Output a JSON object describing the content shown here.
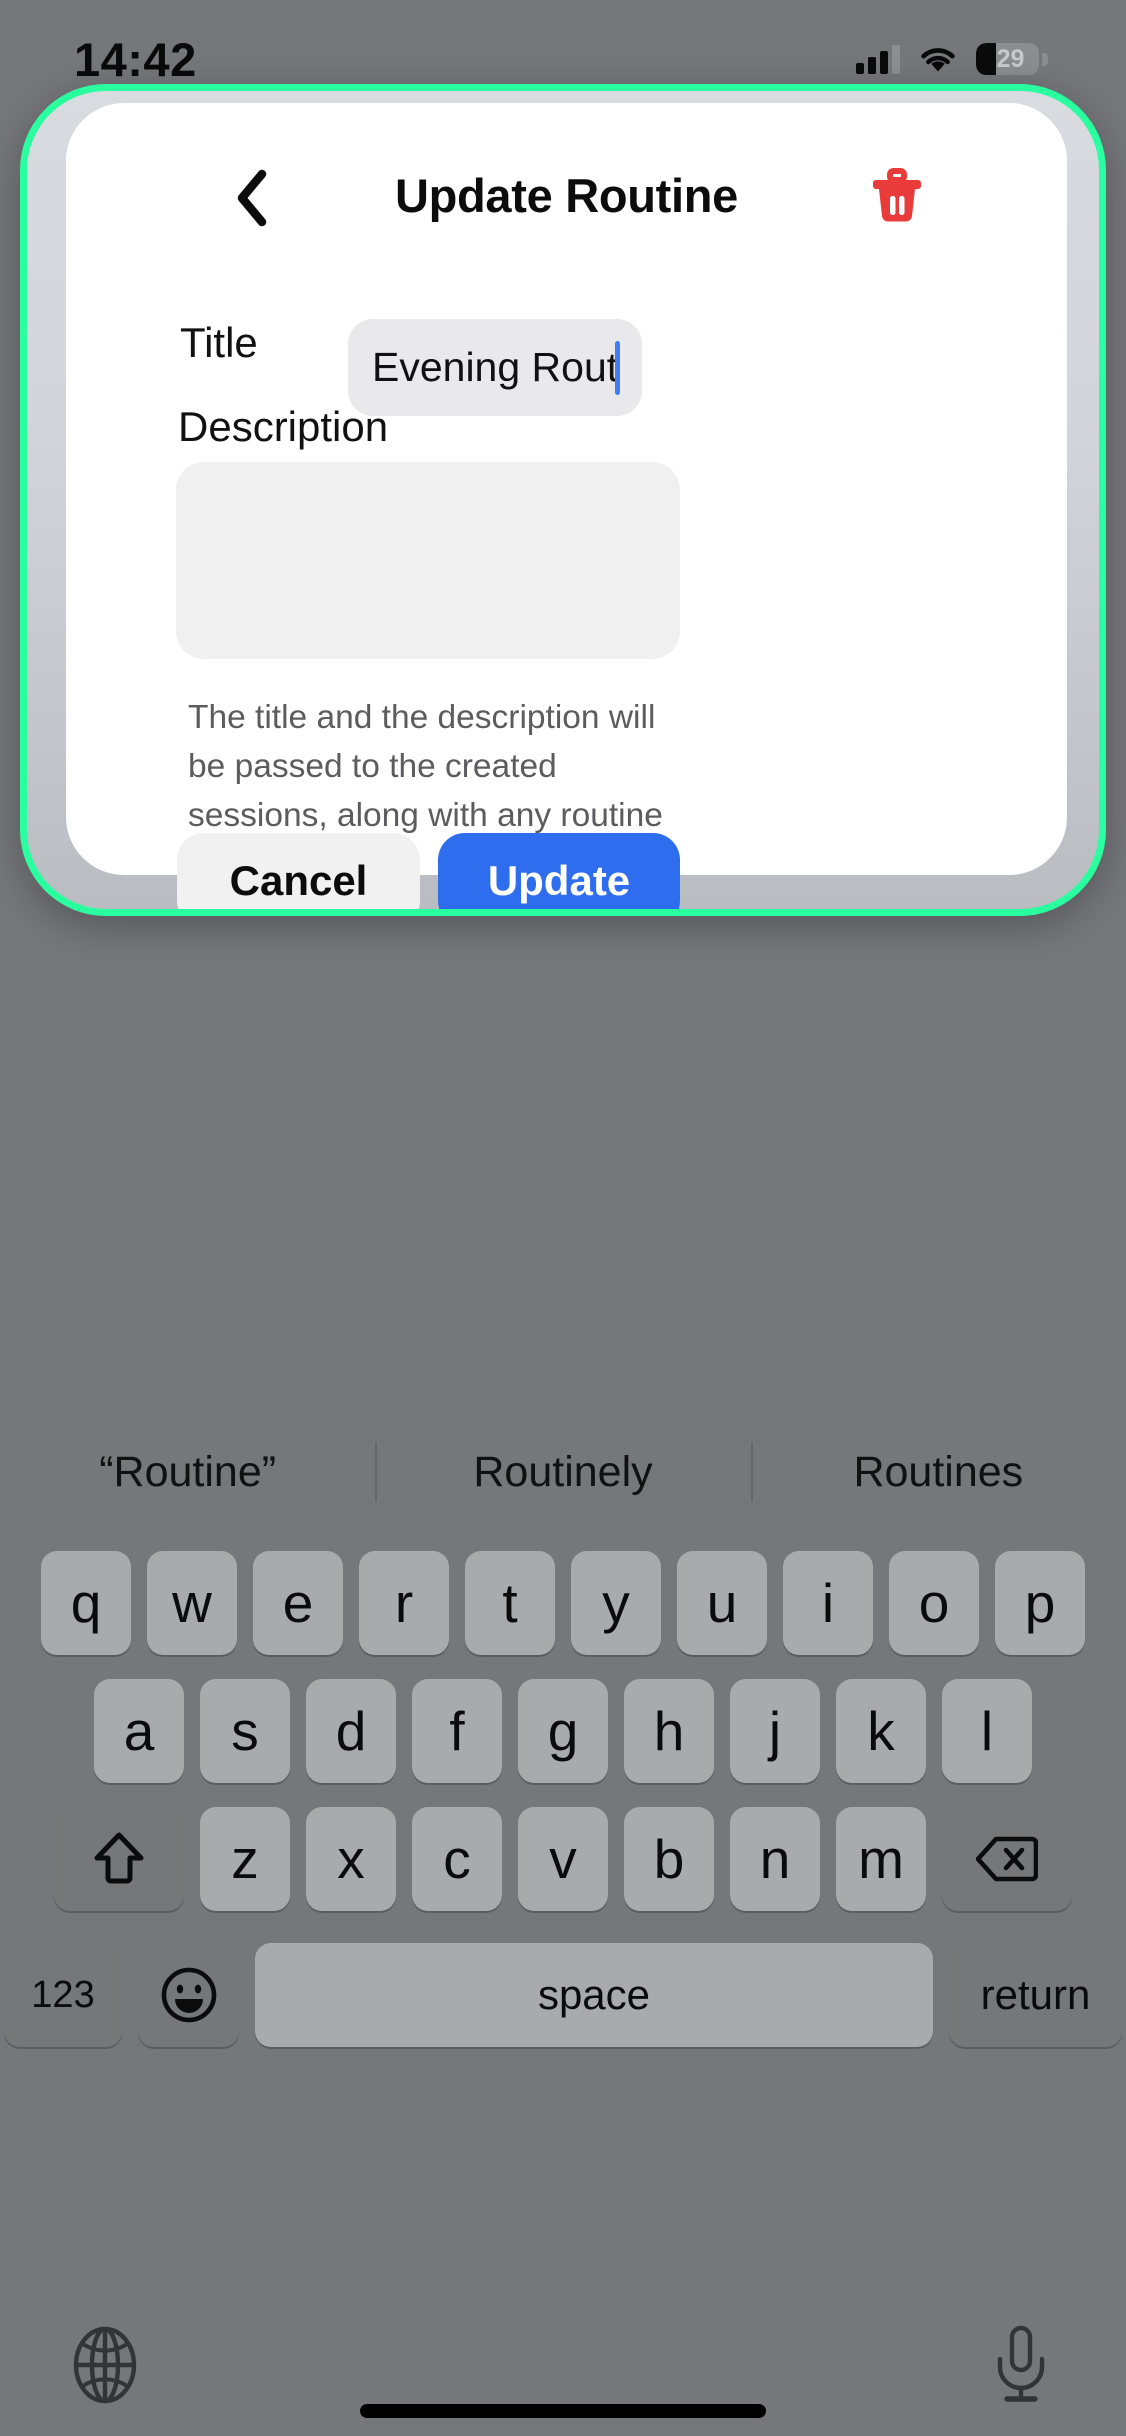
{
  "status_bar": {
    "time": "14:42",
    "battery_percent": "29",
    "battery_level": 29,
    "signal_icon": "cellular-signal-icon",
    "wifi_icon": "wifi-icon",
    "battery_icon": "battery-icon"
  },
  "modal": {
    "title": "Update Routine",
    "back_icon": "chevron-left-icon",
    "delete_icon": "trash-icon",
    "delete_color": "#ea3b3b",
    "accent_border_color": "#2affa0",
    "title_field": {
      "label": "Title",
      "value": "Evening Routine",
      "placeholder": ""
    },
    "description_field": {
      "label": "Description",
      "value": "",
      "placeholder": ""
    },
    "helper_text": "The title and the description will be passed to the created sessions, along with any routine cards.",
    "buttons": {
      "cancel_label": "Cancel",
      "update_label": "Update",
      "update_color": "#2f6def"
    }
  },
  "keyboard": {
    "predictions": [
      "“Routine”",
      "Routinely",
      "Routines"
    ],
    "row1": [
      "q",
      "w",
      "e",
      "r",
      "t",
      "y",
      "u",
      "i",
      "o",
      "p"
    ],
    "row2": [
      "a",
      "s",
      "d",
      "f",
      "g",
      "h",
      "j",
      "k",
      "l"
    ],
    "row3": [
      "z",
      "x",
      "c",
      "v",
      "b",
      "n",
      "m"
    ],
    "shift_icon": "shift-arrow-icon",
    "backspace_icon": "backspace-icon",
    "numbers_label": "123",
    "emoji_icon": "emoji-smiley-icon",
    "space_label": "space",
    "return_label": "return",
    "globe_icon": "globe-icon",
    "mic_icon": "microphone-icon"
  }
}
